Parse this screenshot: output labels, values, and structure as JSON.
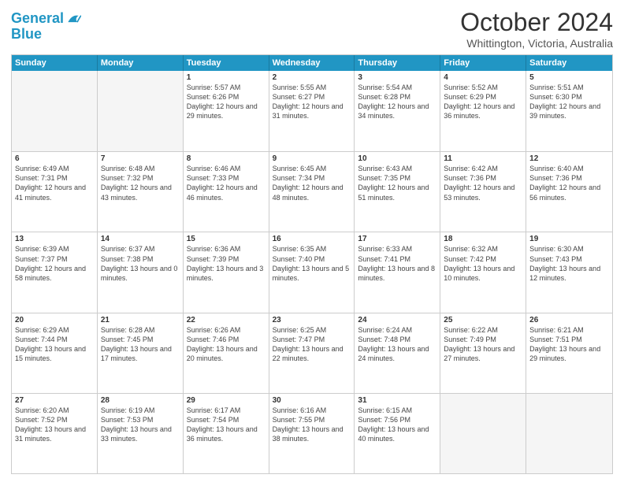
{
  "header": {
    "logo_general": "General",
    "logo_blue": "Blue",
    "month": "October 2024",
    "location": "Whittington, Victoria, Australia"
  },
  "days": [
    "Sunday",
    "Monday",
    "Tuesday",
    "Wednesday",
    "Thursday",
    "Friday",
    "Saturday"
  ],
  "weeks": [
    [
      {
        "day": "",
        "empty": true
      },
      {
        "day": "",
        "empty": true
      },
      {
        "day": "1",
        "sunrise": "Sunrise: 5:57 AM",
        "sunset": "Sunset: 6:26 PM",
        "daylight": "Daylight: 12 hours and 29 minutes."
      },
      {
        "day": "2",
        "sunrise": "Sunrise: 5:55 AM",
        "sunset": "Sunset: 6:27 PM",
        "daylight": "Daylight: 12 hours and 31 minutes."
      },
      {
        "day": "3",
        "sunrise": "Sunrise: 5:54 AM",
        "sunset": "Sunset: 6:28 PM",
        "daylight": "Daylight: 12 hours and 34 minutes."
      },
      {
        "day": "4",
        "sunrise": "Sunrise: 5:52 AM",
        "sunset": "Sunset: 6:29 PM",
        "daylight": "Daylight: 12 hours and 36 minutes."
      },
      {
        "day": "5",
        "sunrise": "Sunrise: 5:51 AM",
        "sunset": "Sunset: 6:30 PM",
        "daylight": "Daylight: 12 hours and 39 minutes."
      }
    ],
    [
      {
        "day": "6",
        "sunrise": "Sunrise: 6:49 AM",
        "sunset": "Sunset: 7:31 PM",
        "daylight": "Daylight: 12 hours and 41 minutes."
      },
      {
        "day": "7",
        "sunrise": "Sunrise: 6:48 AM",
        "sunset": "Sunset: 7:32 PM",
        "daylight": "Daylight: 12 hours and 43 minutes."
      },
      {
        "day": "8",
        "sunrise": "Sunrise: 6:46 AM",
        "sunset": "Sunset: 7:33 PM",
        "daylight": "Daylight: 12 hours and 46 minutes."
      },
      {
        "day": "9",
        "sunrise": "Sunrise: 6:45 AM",
        "sunset": "Sunset: 7:34 PM",
        "daylight": "Daylight: 12 hours and 48 minutes."
      },
      {
        "day": "10",
        "sunrise": "Sunrise: 6:43 AM",
        "sunset": "Sunset: 7:35 PM",
        "daylight": "Daylight: 12 hours and 51 minutes."
      },
      {
        "day": "11",
        "sunrise": "Sunrise: 6:42 AM",
        "sunset": "Sunset: 7:36 PM",
        "daylight": "Daylight: 12 hours and 53 minutes."
      },
      {
        "day": "12",
        "sunrise": "Sunrise: 6:40 AM",
        "sunset": "Sunset: 7:36 PM",
        "daylight": "Daylight: 12 hours and 56 minutes."
      }
    ],
    [
      {
        "day": "13",
        "sunrise": "Sunrise: 6:39 AM",
        "sunset": "Sunset: 7:37 PM",
        "daylight": "Daylight: 12 hours and 58 minutes."
      },
      {
        "day": "14",
        "sunrise": "Sunrise: 6:37 AM",
        "sunset": "Sunset: 7:38 PM",
        "daylight": "Daylight: 13 hours and 0 minutes."
      },
      {
        "day": "15",
        "sunrise": "Sunrise: 6:36 AM",
        "sunset": "Sunset: 7:39 PM",
        "daylight": "Daylight: 13 hours and 3 minutes."
      },
      {
        "day": "16",
        "sunrise": "Sunrise: 6:35 AM",
        "sunset": "Sunset: 7:40 PM",
        "daylight": "Daylight: 13 hours and 5 minutes."
      },
      {
        "day": "17",
        "sunrise": "Sunrise: 6:33 AM",
        "sunset": "Sunset: 7:41 PM",
        "daylight": "Daylight: 13 hours and 8 minutes."
      },
      {
        "day": "18",
        "sunrise": "Sunrise: 6:32 AM",
        "sunset": "Sunset: 7:42 PM",
        "daylight": "Daylight: 13 hours and 10 minutes."
      },
      {
        "day": "19",
        "sunrise": "Sunrise: 6:30 AM",
        "sunset": "Sunset: 7:43 PM",
        "daylight": "Daylight: 13 hours and 12 minutes."
      }
    ],
    [
      {
        "day": "20",
        "sunrise": "Sunrise: 6:29 AM",
        "sunset": "Sunset: 7:44 PM",
        "daylight": "Daylight: 13 hours and 15 minutes."
      },
      {
        "day": "21",
        "sunrise": "Sunrise: 6:28 AM",
        "sunset": "Sunset: 7:45 PM",
        "daylight": "Daylight: 13 hours and 17 minutes."
      },
      {
        "day": "22",
        "sunrise": "Sunrise: 6:26 AM",
        "sunset": "Sunset: 7:46 PM",
        "daylight": "Daylight: 13 hours and 20 minutes."
      },
      {
        "day": "23",
        "sunrise": "Sunrise: 6:25 AM",
        "sunset": "Sunset: 7:47 PM",
        "daylight": "Daylight: 13 hours and 22 minutes."
      },
      {
        "day": "24",
        "sunrise": "Sunrise: 6:24 AM",
        "sunset": "Sunset: 7:48 PM",
        "daylight": "Daylight: 13 hours and 24 minutes."
      },
      {
        "day": "25",
        "sunrise": "Sunrise: 6:22 AM",
        "sunset": "Sunset: 7:49 PM",
        "daylight": "Daylight: 13 hours and 27 minutes."
      },
      {
        "day": "26",
        "sunrise": "Sunrise: 6:21 AM",
        "sunset": "Sunset: 7:51 PM",
        "daylight": "Daylight: 13 hours and 29 minutes."
      }
    ],
    [
      {
        "day": "27",
        "sunrise": "Sunrise: 6:20 AM",
        "sunset": "Sunset: 7:52 PM",
        "daylight": "Daylight: 13 hours and 31 minutes."
      },
      {
        "day": "28",
        "sunrise": "Sunrise: 6:19 AM",
        "sunset": "Sunset: 7:53 PM",
        "daylight": "Daylight: 13 hours and 33 minutes."
      },
      {
        "day": "29",
        "sunrise": "Sunrise: 6:17 AM",
        "sunset": "Sunset: 7:54 PM",
        "daylight": "Daylight: 13 hours and 36 minutes."
      },
      {
        "day": "30",
        "sunrise": "Sunrise: 6:16 AM",
        "sunset": "Sunset: 7:55 PM",
        "daylight": "Daylight: 13 hours and 38 minutes."
      },
      {
        "day": "31",
        "sunrise": "Sunrise: 6:15 AM",
        "sunset": "Sunset: 7:56 PM",
        "daylight": "Daylight: 13 hours and 40 minutes."
      },
      {
        "day": "",
        "empty": true
      },
      {
        "day": "",
        "empty": true
      }
    ]
  ]
}
